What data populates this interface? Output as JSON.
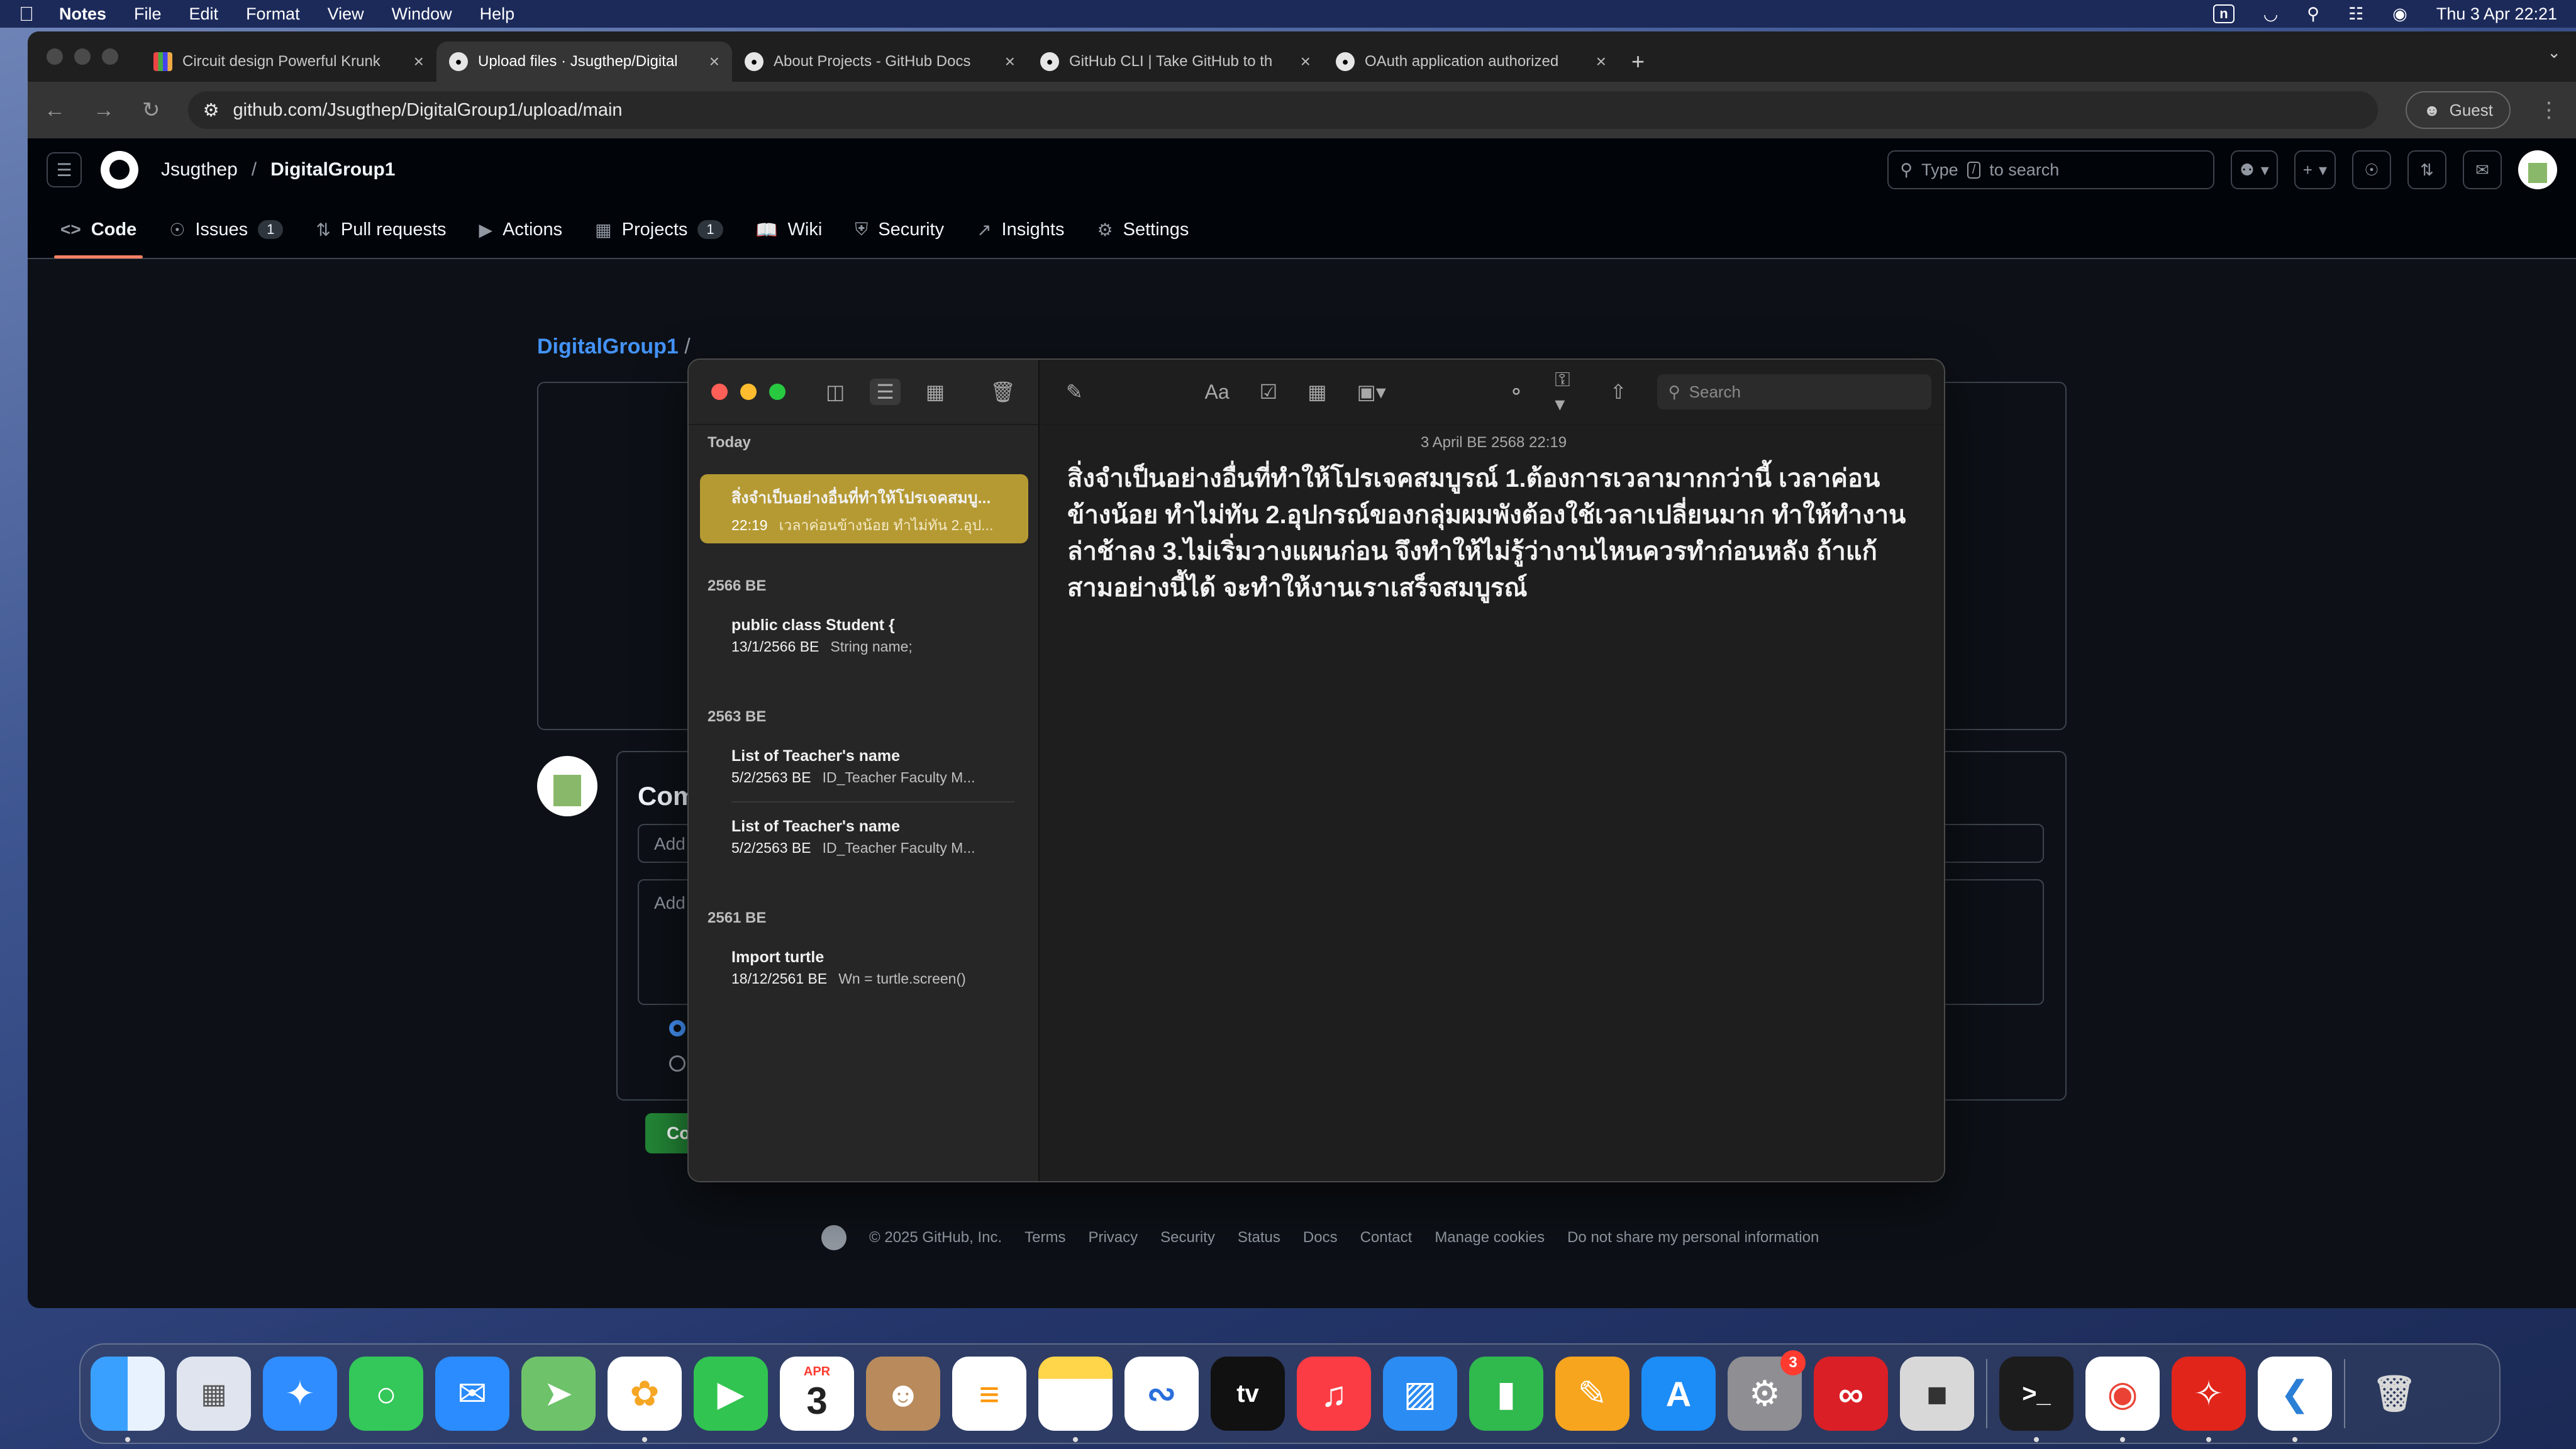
{
  "menubar": {
    "app": "Notes",
    "items": [
      "File",
      "Edit",
      "Format",
      "View",
      "Window",
      "Help"
    ],
    "clock": "Thu 3 Apr  22:21",
    "input_badge": "n"
  },
  "browser": {
    "tabs": [
      {
        "title": "Circuit design Powerful Krunk",
        "favicon": "circuit-favicon"
      },
      {
        "title": "Upload files · Jsugthep/Digital",
        "favicon": "github-favicon"
      },
      {
        "title": "About Projects - GitHub Docs",
        "favicon": "github-favicon"
      },
      {
        "title": "GitHub CLI | Take GitHub to th",
        "favicon": "github-favicon"
      },
      {
        "title": "OAuth application authorized",
        "favicon": "github-favicon"
      }
    ],
    "url": "github.com/Jsugthep/DigitalGroup1/upload/main",
    "profile": "Guest"
  },
  "github": {
    "owner": "Jsugthep",
    "repo": "DigitalGroup1",
    "search_placeholder_pre": "Type",
    "search_key": "/",
    "search_placeholder_post": "to search",
    "nav": [
      {
        "label": "Code",
        "icon": "code-icon",
        "count": ""
      },
      {
        "label": "Issues",
        "icon": "issue-icon",
        "count": "1"
      },
      {
        "label": "Pull requests",
        "icon": "pull-request-icon",
        "count": ""
      },
      {
        "label": "Actions",
        "icon": "play-icon",
        "count": ""
      },
      {
        "label": "Projects",
        "icon": "table-icon",
        "count": "1"
      },
      {
        "label": "Wiki",
        "icon": "book-icon",
        "count": ""
      },
      {
        "label": "Security",
        "icon": "shield-icon",
        "count": ""
      },
      {
        "label": "Insights",
        "icon": "graph-icon",
        "count": ""
      },
      {
        "label": "Settings",
        "icon": "gear-icon",
        "count": ""
      }
    ],
    "breadcrumb_repo": "DigitalGroup1",
    "breadcrumb_sep": "/",
    "commit_title_partial": "Com",
    "commit_summary_partial": "Add",
    "commit_desc_partial": "Add",
    "commit_button_partial": "Comm",
    "footer": {
      "copyright": "© 2025 GitHub, Inc.",
      "links": [
        "Terms",
        "Privacy",
        "Security",
        "Status",
        "Docs",
        "Contact",
        "Manage cookies",
        "Do not share my personal information"
      ]
    }
  },
  "notes": {
    "search_placeholder": "Search",
    "date": "3 April BE 2568 22:19",
    "body": "สิ่งจำเป็นอย่างอื่นที่ทำให้โปรเจคสมบูรณ์  1.ต้องการเวลามากกว่านี้ เวลาค่อนข้างน้อย ทำไม่ทัน 2.อุปกรณ์ของกลุ่มผมพังต้องใช้เวลาเปลี่ยนมาก ทำให้ทำงานล่าช้าลง 3.ไม่เริ่มวางแผนก่อน จึงทำให้ไม่รู้ว่างานไหนควรทำก่อนหลัง  ถ้าแก้สามอย่างนี้ได้ จะทำให้งานเราเสร็จสมบูรณ์",
    "sections": [
      {
        "header": "Today",
        "items": [
          {
            "title": "สิ่งจำเป็นอย่างอื่นที่ทำให้โปรเจคสมบู...",
            "meta": "22:19",
            "snippet": "เวลาค่อนข้างน้อย ทำไม่ทัน 2.อุป..."
          }
        ]
      },
      {
        "header": "2566 BE",
        "items": [
          {
            "title": "public class Student {",
            "meta": "13/1/2566 BE",
            "snippet": "String name;"
          }
        ]
      },
      {
        "header": "2563 BE",
        "items": [
          {
            "title": "List of Teacher's name",
            "meta": "5/2/2563 BE",
            "snippet": "ID_Teacher Faculty M..."
          },
          {
            "title": "List of Teacher's name",
            "meta": "5/2/2563 BE",
            "snippet": "ID_Teacher Faculty M..."
          }
        ]
      },
      {
        "header": "2561 BE",
        "items": [
          {
            "title": "Import turtle",
            "meta": "18/12/2561 BE",
            "snippet": "Wn = turtle.screen()"
          }
        ]
      }
    ]
  },
  "dock": {
    "apps": [
      "Finder",
      "Launchpad",
      "Safari",
      "Messages",
      "Mail",
      "Maps",
      "Photos",
      "FaceTime",
      "Calendar",
      "Contacts",
      "Reminders",
      "Notes",
      "Freeform",
      "TV",
      "Music",
      "Keynote",
      "Numbers",
      "Pages",
      "App Store",
      "System Settings",
      "Creative Cloud",
      "Roblox",
      "Terminal",
      "Chrome",
      "Acrobat",
      "VS Code",
      "Trash"
    ],
    "calendar_month": "APR",
    "calendar_day": "3",
    "settings_badge": "3"
  },
  "colors": {
    "accent_blue": "#4493f8",
    "gh_green": "#238636",
    "nav_underline": "#f78166",
    "note_selected": "#b59a33"
  }
}
